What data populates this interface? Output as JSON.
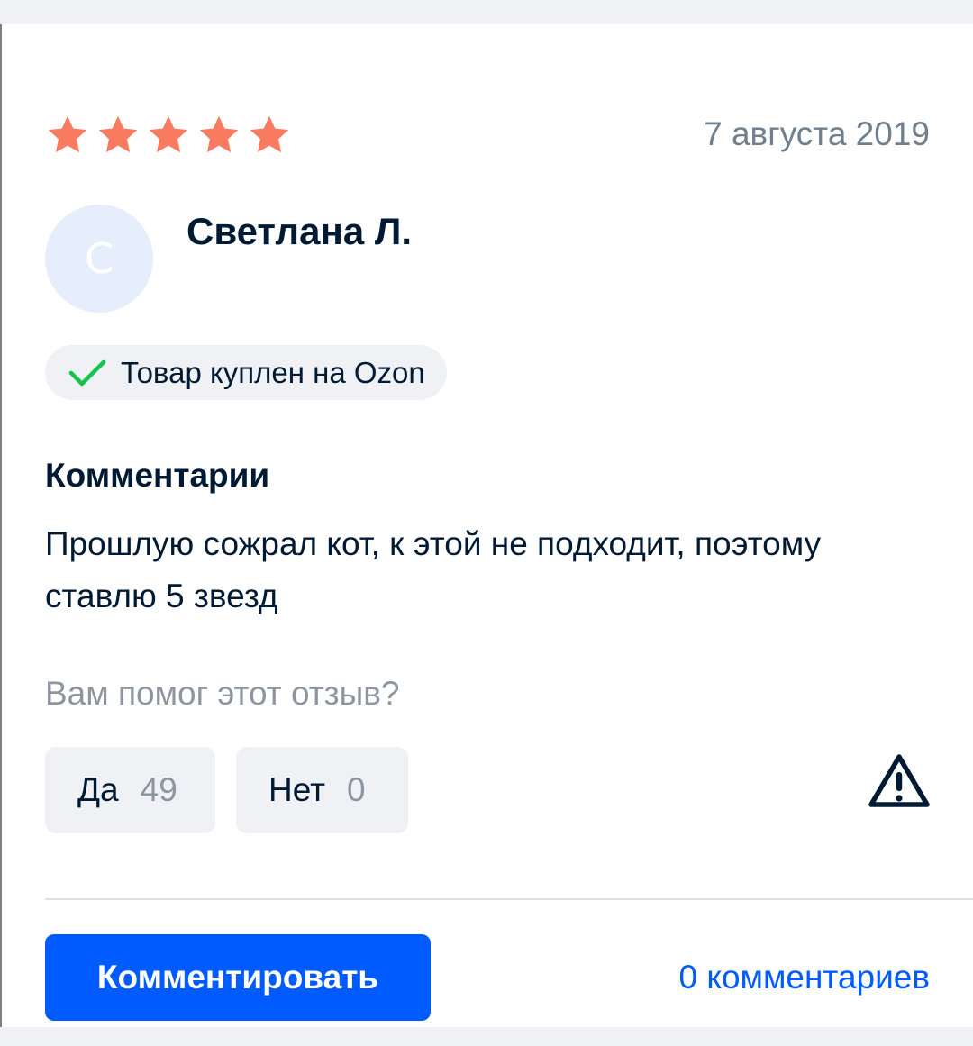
{
  "review": {
    "rating": 5,
    "rating_max": 5,
    "date": "7 августа 2019",
    "author": {
      "initial": "С",
      "name": "Светлана Л."
    },
    "verified_label": "Товар куплен на Ozon",
    "comment_heading": "Комментарии",
    "comment_text": "Прошлую сожрал кот, к этой не подходит, поэтому ставлю 5 звезд"
  },
  "helpful": {
    "question": "Вам помог этот отзыв?",
    "yes_label": "Да",
    "yes_count": "49",
    "no_label": "Нет",
    "no_count": "0"
  },
  "actions": {
    "comment_button": "Комментировать",
    "comments_count_link": "0 комментариев"
  },
  "colors": {
    "star": "#f97b5f",
    "accent": "#005bff",
    "check": "#10c44c",
    "text_primary": "#001a34",
    "text_secondary": "#707f8d"
  },
  "icons": {
    "star": "star-icon",
    "verified": "checkmark-icon",
    "report": "warning-triangle-icon"
  }
}
